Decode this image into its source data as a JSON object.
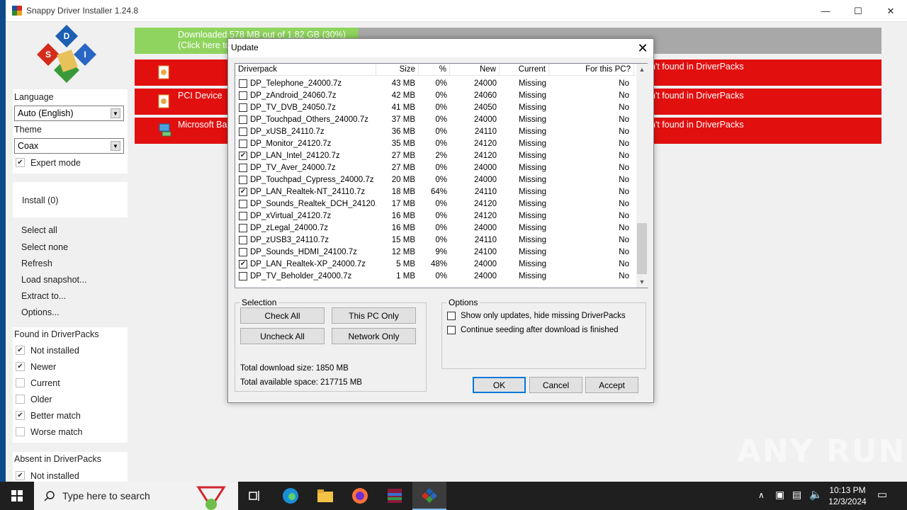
{
  "window": {
    "title": "Snappy Driver Installer 1.24.8"
  },
  "download_bar": {
    "line1": "Downloaded 578 MB out of 1.82 GB (30%)",
    "line2": "(Click here to",
    "progress_fraction": 0.3
  },
  "sidebar": {
    "language_label": "Language",
    "language_value": "Auto (English)",
    "theme_label": "Theme",
    "theme_value": "Coax",
    "expert_mode": "Expert mode",
    "install": "Install (0)",
    "actions": [
      "Select all",
      "Select none",
      "Refresh",
      "Load snapshot...",
      "Extract to...",
      "Options..."
    ],
    "found_title": "Found in DriverPacks",
    "found_items": [
      {
        "label": "Not installed",
        "checked": true
      },
      {
        "label": "Newer",
        "checked": true
      },
      {
        "label": "Current",
        "checked": false
      },
      {
        "label": "Older",
        "checked": false
      },
      {
        "label": "Better match",
        "checked": true
      },
      {
        "label": "Worse match",
        "checked": false
      }
    ],
    "absent_title": "Absent in DriverPacks",
    "absent_items": [
      {
        "label": "Not installed",
        "checked": true
      }
    ]
  },
  "device_bars": [
    {
      "name": "",
      "status": "n't found in DriverPacks"
    },
    {
      "name": "PCI Device",
      "status": "n't found in DriverPacks"
    },
    {
      "name": "Microsoft Ba",
      "status": "n't found in DriverPacks"
    }
  ],
  "dialog": {
    "title": "Update",
    "columns": [
      "Driverpack",
      "Size",
      "%",
      "New",
      "Current",
      "For this PC?"
    ],
    "rows": [
      {
        "name": "DP_Telephone_24000.7z",
        "size": "43 MB",
        "pct": "0%",
        "new": "24000",
        "current": "Missing",
        "for_pc": "No",
        "checked": false
      },
      {
        "name": "DP_zAndroid_24060.7z",
        "size": "42 MB",
        "pct": "0%",
        "new": "24060",
        "current": "Missing",
        "for_pc": "No",
        "checked": false
      },
      {
        "name": "DP_TV_DVB_24050.7z",
        "size": "41 MB",
        "pct": "0%",
        "new": "24050",
        "current": "Missing",
        "for_pc": "No",
        "checked": false
      },
      {
        "name": "DP_Touchpad_Others_24000.7z",
        "size": "37 MB",
        "pct": "0%",
        "new": "24000",
        "current": "Missing",
        "for_pc": "No",
        "checked": false
      },
      {
        "name": "DP_xUSB_24110.7z",
        "size": "36 MB",
        "pct": "0%",
        "new": "24110",
        "current": "Missing",
        "for_pc": "No",
        "checked": false
      },
      {
        "name": "DP_Monitor_24120.7z",
        "size": "35 MB",
        "pct": "0%",
        "new": "24120",
        "current": "Missing",
        "for_pc": "No",
        "checked": false
      },
      {
        "name": "DP_LAN_Intel_24120.7z",
        "size": "27 MB",
        "pct": "2%",
        "new": "24120",
        "current": "Missing",
        "for_pc": "No",
        "checked": true
      },
      {
        "name": "DP_TV_Aver_24000.7z",
        "size": "27 MB",
        "pct": "0%",
        "new": "24000",
        "current": "Missing",
        "for_pc": "No",
        "checked": false
      },
      {
        "name": "DP_Touchpad_Cypress_24000.7z",
        "size": "20 MB",
        "pct": "0%",
        "new": "24000",
        "current": "Missing",
        "for_pc": "No",
        "checked": false
      },
      {
        "name": "DP_LAN_Realtek-NT_24110.7z",
        "size": "18 MB",
        "pct": "64%",
        "new": "24110",
        "current": "Missing",
        "for_pc": "No",
        "checked": true
      },
      {
        "name": "DP_Sounds_Realtek_DCH_24120....",
        "size": "17 MB",
        "pct": "0%",
        "new": "24120",
        "current": "Missing",
        "for_pc": "No",
        "checked": false
      },
      {
        "name": "DP_xVirtual_24120.7z",
        "size": "16 MB",
        "pct": "0%",
        "new": "24120",
        "current": "Missing",
        "for_pc": "No",
        "checked": false
      },
      {
        "name": "DP_zLegal_24000.7z",
        "size": "16 MB",
        "pct": "0%",
        "new": "24000",
        "current": "Missing",
        "for_pc": "No",
        "checked": false
      },
      {
        "name": "DP_zUSB3_24110.7z",
        "size": "15 MB",
        "pct": "0%",
        "new": "24110",
        "current": "Missing",
        "for_pc": "No",
        "checked": false
      },
      {
        "name": "DP_Sounds_HDMI_24100.7z",
        "size": "12 MB",
        "pct": "9%",
        "new": "24100",
        "current": "Missing",
        "for_pc": "No",
        "checked": false
      },
      {
        "name": "DP_LAN_Realtek-XP_24000.7z",
        "size": "5 MB",
        "pct": "48%",
        "new": "24000",
        "current": "Missing",
        "for_pc": "No",
        "checked": true
      },
      {
        "name": "DP_TV_Beholder_24000.7z",
        "size": "1 MB",
        "pct": "0%",
        "new": "24000",
        "current": "Missing",
        "for_pc": "No",
        "checked": false
      }
    ],
    "selection": {
      "title": "Selection",
      "check_all": "Check All",
      "this_pc_only": "This PC Only",
      "uncheck_all": "Uncheck All",
      "network_only": "Network Only",
      "total_download": "Total download size: 1850 MB",
      "total_space": "Total available space: 217715 MB"
    },
    "options": {
      "title": "Options",
      "opt1": "Show only updates, hide missing DriverPacks",
      "opt2": "Continue seeding after download is finished"
    },
    "ok": "OK",
    "cancel": "Cancel",
    "accept": "Accept"
  },
  "taskbar": {
    "search_placeholder": "Type here to search",
    "time": "10:13 PM",
    "date": "12/3/2024"
  },
  "watermark": "ANY RUN",
  "colors": {
    "red_bar": "#e20f0f",
    "progress_fill": "#8fd45e",
    "taskbar": "#1f1f1f"
  }
}
